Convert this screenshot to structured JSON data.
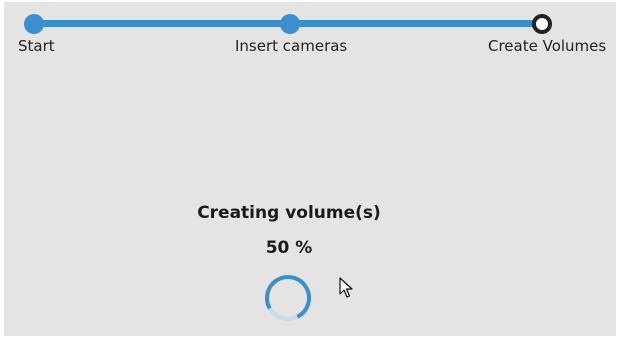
{
  "wizard": {
    "steps": [
      {
        "label": "Start",
        "state": "complete"
      },
      {
        "label": "Insert cameras",
        "state": "complete"
      },
      {
        "label": "Create Volumes",
        "state": "current"
      }
    ],
    "accent_color": "#3a8fcc"
  },
  "progress": {
    "title": "Creating volume(s)",
    "percent_label": "50 %",
    "percent": 50,
    "spinner_icon": "loading-spinner-icon"
  },
  "cursor_icon": "mouse-pointer-icon"
}
